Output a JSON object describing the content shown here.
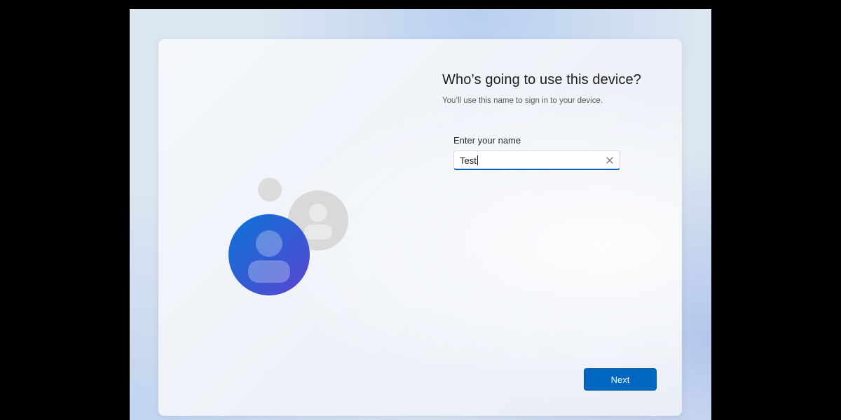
{
  "oobe": {
    "title": "Who’s going to use this device?",
    "subtitle": "You’ll use this name to sign in to your device.",
    "name_field": {
      "label": "Enter your name",
      "value": "Test"
    },
    "next_label": "Next",
    "icons": {
      "illustration": "users-illustration-icon",
      "clear": "close-icon"
    },
    "colors": {
      "accent": "#0067c0",
      "avatar_gradient_start": "#0a74d8",
      "avatar_gradient_end": "#5a45d0",
      "secondary_avatar": "#d9d9d9"
    }
  }
}
